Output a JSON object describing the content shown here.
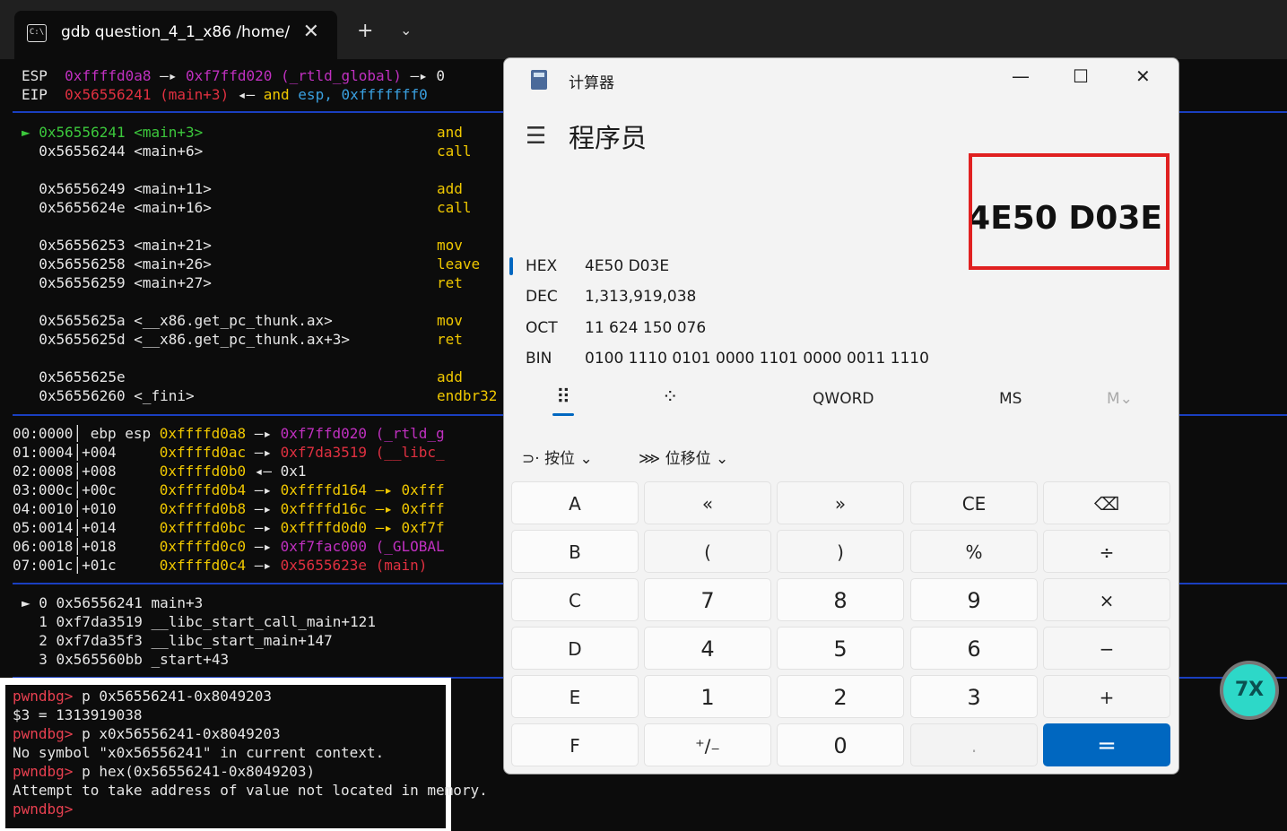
{
  "terminal": {
    "tab_title": "gdb question_4_1_x86 /home/",
    "tab_close": "✕",
    "new_tab": "+",
    "dropdown": "⌄",
    "regs": [
      {
        "name": "ESP",
        "a": "0xffffd0a8",
        "arrow": "—▸",
        "b": "0xf7ffd020 (_rtld_global)",
        "c": "—▸ 0"
      },
      {
        "name": "EIP",
        "a": "0x56556241 (main+3)",
        "arrow": "◂—",
        "b": "and",
        "c": "esp, 0xfffffff0"
      }
    ],
    "disasm": [
      {
        "addr": "► 0x56556241 <main+3>",
        "op": "and"
      },
      {
        "addr": "  0x56556244 <main+6>",
        "op": "call"
      },
      {
        "addr": "  0x56556249 <main+11>",
        "op": "add"
      },
      {
        "addr": "  0x5655624e <main+16>",
        "op": "call"
      },
      {
        "addr": "  0x56556253 <main+21>",
        "op": "mov"
      },
      {
        "addr": "  0x56556258 <main+26>",
        "op": "leave"
      },
      {
        "addr": "  0x56556259 <main+27>",
        "op": "ret"
      },
      {
        "addr": "  0x5655625a <__x86.get_pc_thunk.ax>",
        "op": "mov"
      },
      {
        "addr": "  0x5655625d <__x86.get_pc_thunk.ax+3>",
        "op": "ret"
      },
      {
        "addr": "  0x5655625e",
        "op": "add"
      },
      {
        "addr": "  0x56556260 <_fini>",
        "op": "endbr32"
      }
    ],
    "stack": [
      {
        "idx": "00:0000",
        "off": " ebp esp",
        "addr": "0xffffd0a8",
        "arr": "—▸",
        "val": "0xf7ffd020 (_rtld_g"
      },
      {
        "idx": "01:0004",
        "off": "+004",
        "addr": "0xffffd0ac",
        "arr": "—▸",
        "val": "0xf7da3519 (__libc_"
      },
      {
        "idx": "02:0008",
        "off": "+008",
        "addr": "0xffffd0b0",
        "arr": "◂—",
        "val": "0x1"
      },
      {
        "idx": "03:000c",
        "off": "+00c",
        "addr": "0xffffd0b4",
        "arr": "—▸",
        "val": "0xffffd164 —▸ 0xfff"
      },
      {
        "idx": "04:0010",
        "off": "+010",
        "addr": "0xffffd0b8",
        "arr": "—▸",
        "val": "0xffffd16c —▸ 0xfff"
      },
      {
        "idx": "05:0014",
        "off": "+014",
        "addr": "0xffffd0bc",
        "arr": "—▸",
        "val": "0xffffd0d0 —▸ 0xf7f"
      },
      {
        "idx": "06:0018",
        "off": "+018",
        "addr": "0xffffd0c0",
        "arr": "—▸",
        "val": "0xf7fac000 (_GLOBAL"
      },
      {
        "idx": "07:001c",
        "off": "+01c",
        "addr": "0xffffd0c4",
        "arr": "—▸",
        "val": "0x5655623e (main)"
      }
    ],
    "backtrace": [
      "► 0 0x56556241 main+3",
      "  1 0xf7da3519 __libc_start_call_main+121",
      "  2 0xf7da35f3 __libc_start_main+147",
      "  3 0x565560bb _start+43"
    ],
    "console": [
      {
        "prompt": "pwndbg>",
        "text": " p 0x56556241-0x8049203"
      },
      {
        "prompt": "",
        "text": "$3 = 1313919038"
      },
      {
        "prompt": "pwndbg>",
        "text": " p x0x56556241-0x8049203"
      },
      {
        "prompt": "",
        "text": "No symbol \"x0x56556241\" in current context."
      },
      {
        "prompt": "pwndbg>",
        "text": " p hex(0x56556241-0x8049203)"
      },
      {
        "prompt": "",
        "text": "Attempt to take address of value not located in memory."
      },
      {
        "prompt": "pwndbg>",
        "text": ""
      }
    ]
  },
  "calculator": {
    "window_title": "计算器",
    "minimize": "—",
    "maximize": "☐",
    "close": "✕",
    "menu_icon": "☰",
    "mode": "程序员",
    "display": "4E50 D03E",
    "radix": [
      {
        "label": "HEX",
        "value": "4E50 D03E"
      },
      {
        "label": "DEC",
        "value": "1,313,919,038"
      },
      {
        "label": "OCT",
        "value": "11 624 150 076"
      },
      {
        "label": "BIN",
        "value": "0100 1110 0101 0000 1101 0000 0011 1110"
      }
    ],
    "keypad_icon": "⠿",
    "bitflip_icon": "⁘",
    "word_size": "QWORD",
    "ms": "MS",
    "mv": "M⌄",
    "bitwise": "按位",
    "bitshift": "位移位",
    "keys": [
      [
        "A",
        "«",
        "»",
        "CE",
        "⌫"
      ],
      [
        "B",
        "(",
        ")",
        "%",
        "÷"
      ],
      [
        "C",
        "7",
        "8",
        "9",
        "×"
      ],
      [
        "D",
        "4",
        "5",
        "6",
        "−"
      ],
      [
        "E",
        "1",
        "2",
        "3",
        "+"
      ],
      [
        "F",
        "⁺∕₋",
        "0",
        ".",
        "="
      ]
    ]
  },
  "colors": {
    "accent": "#0067c0",
    "red_box": "#e02020",
    "term_bg": "#0c0c0c"
  }
}
